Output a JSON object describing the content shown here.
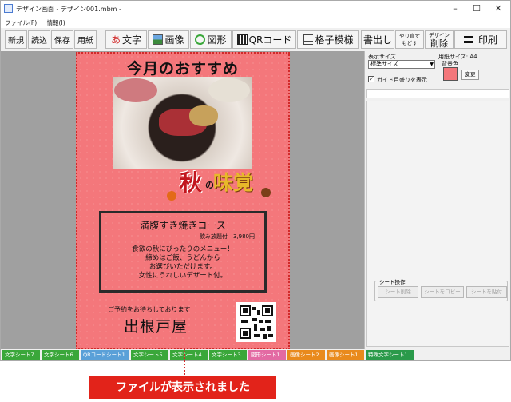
{
  "window": {
    "title": "デザイン画面 - デザイン001.mbm -",
    "controls": [
      "–",
      "☐",
      "✕"
    ]
  },
  "menu": [
    "ファイル(F)",
    "情報(I)"
  ],
  "toolbar": {
    "new": "新規",
    "load": "読込",
    "save": "保存",
    "paper": "用紙",
    "text": "文字",
    "text_icon": "あ",
    "image": "画像",
    "shape": "図形",
    "qr": "QRコード",
    "grid_pattern": "格子模様",
    "push_out": "書出し",
    "redo": "やり直す",
    "undo": "もどす",
    "design_label": "デザイン",
    "delete": "削除",
    "print": "印刷"
  },
  "flyer": {
    "title": "今月のおすすめ",
    "badge_aki": "秋",
    "badge_no": "の",
    "badge_mikaku": "味覚",
    "course_title": "満腹すき焼きコース",
    "course_price": "飲み放題付　3,980円",
    "course_desc": [
      "食欲の秋にぴったりのメニュー！",
      "締めはご飯、うどんから",
      "お選びいただけます。",
      "女性にうれしいデザート付。"
    ],
    "reserve": "ご予約をお待ちしております！",
    "shop_name": "出根戸屋"
  },
  "panel": {
    "display_size_label": "表示サイズ",
    "display_size_value": "標準サイズ",
    "paper_size_label": "用紙サイズ: A4",
    "bg_color_label": "背景色",
    "bg_color": "#f4777b",
    "change_button": "変更",
    "grid_check_label": "ガイド目盛りを表示",
    "grid_checked": "✓",
    "sheet_ops_label": "シート操作",
    "sheet_delete": "シート削除",
    "sheet_copy": "シートをコピー",
    "sheet_paste": "シートを貼付"
  },
  "tabs": [
    {
      "label": "文字シート7",
      "color": "#3aa73a"
    },
    {
      "label": "文字シート6",
      "color": "#3aa73a"
    },
    {
      "label": "QRコードシート1",
      "color": "#5aa0d8"
    },
    {
      "label": "文字シート5",
      "color": "#3aa73a"
    },
    {
      "label": "文字シート4",
      "color": "#3aa73a"
    },
    {
      "label": "文字シート3",
      "color": "#3aa73a"
    },
    {
      "label": "図形シート1",
      "color": "#e36aa3"
    },
    {
      "label": "画像シート2",
      "color": "#e98a1c"
    },
    {
      "label": "画像シート1",
      "color": "#e98a1c"
    },
    {
      "label": "特殊文字シート1",
      "color": "#2a9a4a"
    }
  ],
  "status_banner": "ファイルが表示されました"
}
